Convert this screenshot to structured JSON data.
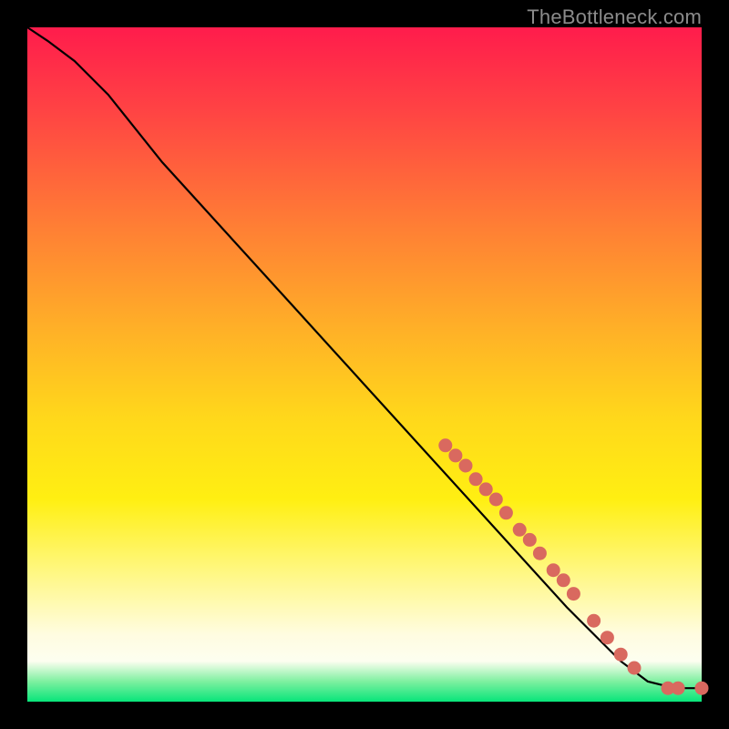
{
  "attribution": "TheBottleneck.com",
  "chart_data": {
    "type": "line",
    "title": "",
    "xlabel": "",
    "ylabel": "",
    "xlim": [
      0,
      100
    ],
    "ylim": [
      0,
      100
    ],
    "curve": [
      {
        "x": 0,
        "y": 100
      },
      {
        "x": 3,
        "y": 98
      },
      {
        "x": 7,
        "y": 95
      },
      {
        "x": 12,
        "y": 90
      },
      {
        "x": 20,
        "y": 80
      },
      {
        "x": 30,
        "y": 69
      },
      {
        "x": 40,
        "y": 58
      },
      {
        "x": 50,
        "y": 47
      },
      {
        "x": 60,
        "y": 36
      },
      {
        "x": 70,
        "y": 25
      },
      {
        "x": 80,
        "y": 14
      },
      {
        "x": 88,
        "y": 6
      },
      {
        "x": 92,
        "y": 3
      },
      {
        "x": 96,
        "y": 2
      },
      {
        "x": 100,
        "y": 2
      }
    ],
    "markers": [
      {
        "x": 62,
        "y": 38
      },
      {
        "x": 63.5,
        "y": 36.5
      },
      {
        "x": 65,
        "y": 35
      },
      {
        "x": 66.5,
        "y": 33
      },
      {
        "x": 68,
        "y": 31.5
      },
      {
        "x": 69.5,
        "y": 30
      },
      {
        "x": 71,
        "y": 28
      },
      {
        "x": 73,
        "y": 25.5
      },
      {
        "x": 74.5,
        "y": 24
      },
      {
        "x": 76,
        "y": 22
      },
      {
        "x": 78,
        "y": 19.5
      },
      {
        "x": 79.5,
        "y": 18
      },
      {
        "x": 81,
        "y": 16
      },
      {
        "x": 84,
        "y": 12
      },
      {
        "x": 86,
        "y": 9.5
      },
      {
        "x": 88,
        "y": 7
      },
      {
        "x": 90,
        "y": 5
      },
      {
        "x": 95,
        "y": 2
      },
      {
        "x": 96.5,
        "y": 2
      },
      {
        "x": 100,
        "y": 2
      }
    ],
    "marker_radius_px": 7
  }
}
